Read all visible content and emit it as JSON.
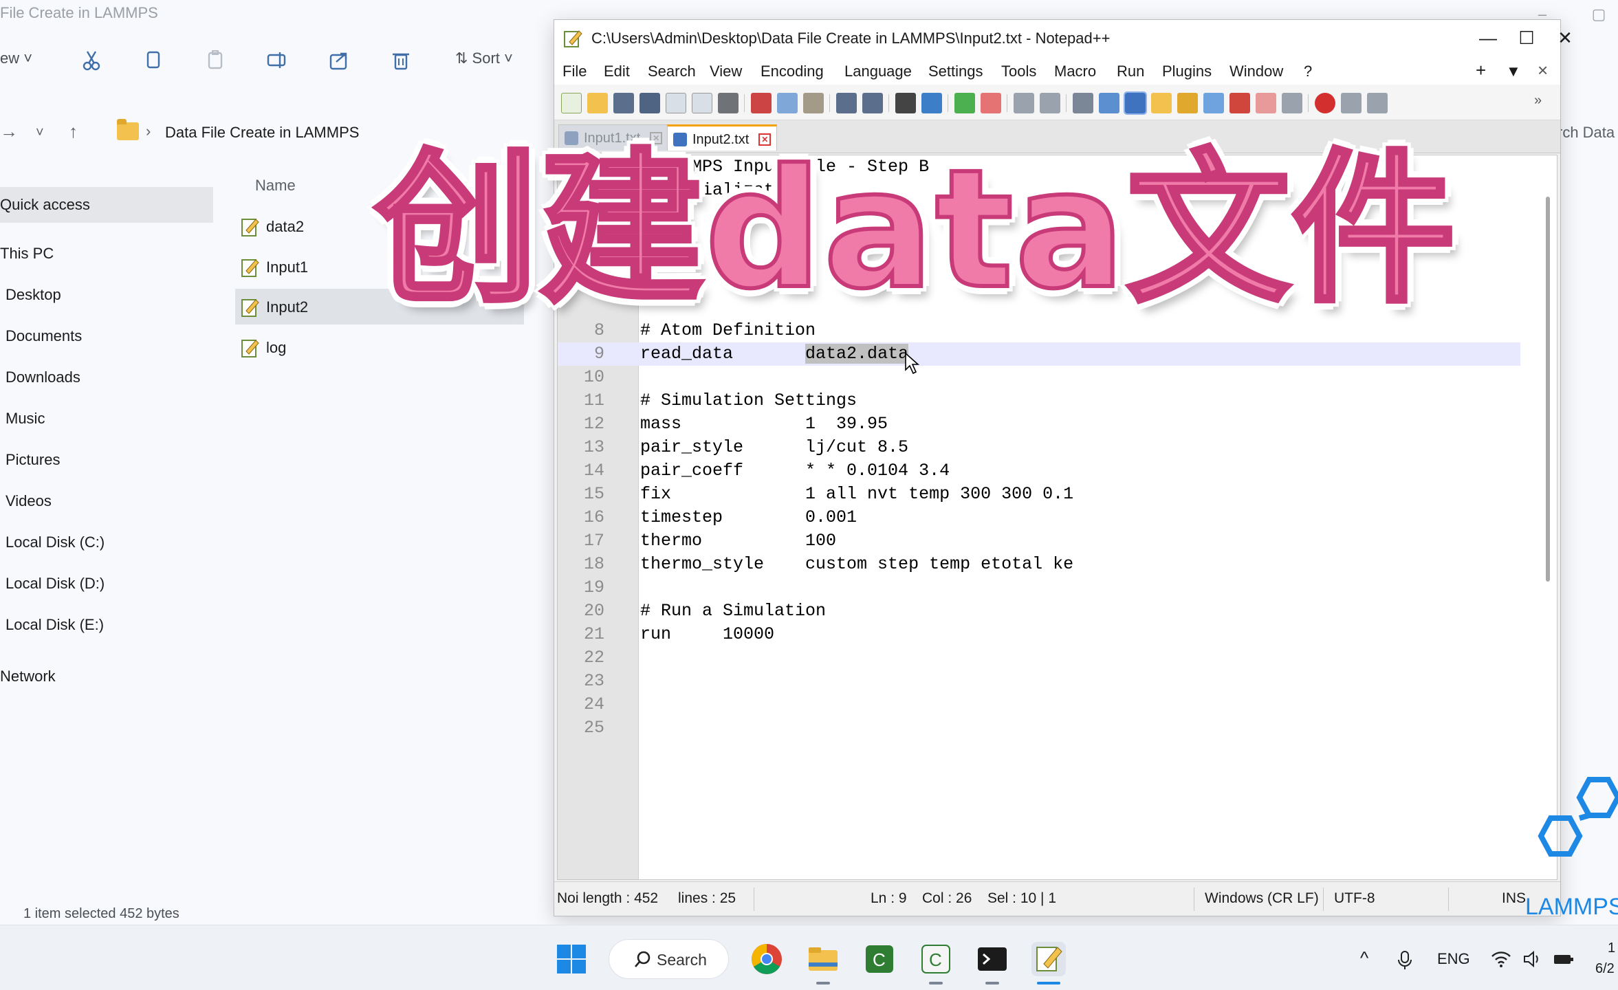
{
  "explorer": {
    "title": "File Create in LAMMPS",
    "toolbar": {
      "view_label": "ew",
      "sort_label": "Sort"
    },
    "address": {
      "crumb": "Data File Create in LAMMPS"
    },
    "search_hint": "rch Data",
    "nav_items": [
      "Quick access",
      "This PC",
      "Desktop",
      "Documents",
      "Downloads",
      "Music",
      "Pictures",
      "Videos",
      "Local Disk (C:)",
      "Local Disk (D:)",
      "Local Disk (E:)",
      "Network"
    ],
    "column_name": "Name",
    "files": [
      "data2",
      "Input1",
      "Input2",
      "log"
    ],
    "status": "1 item selected  452 bytes"
  },
  "npp": {
    "title": "C:\\Users\\Admin\\Desktop\\Data File Create in LAMMPS\\Input2.txt - Notepad++",
    "menu": [
      "File",
      "Edit",
      "Search",
      "View",
      "Encoding",
      "Language",
      "Settings",
      "Tools",
      "Macro",
      "Run",
      "Plugins",
      "Window",
      "?"
    ],
    "menu_right": [
      "+",
      "▼",
      "×"
    ],
    "tabs": [
      {
        "label": "Input1.txt",
        "active": false
      },
      {
        "label": "Input2.txt",
        "active": true
      }
    ],
    "lines": [
      {
        "n": "1",
        "text": "# LAMMPS Input File - Step B"
      },
      {
        "n": "2",
        "text": "# Initialization"
      },
      {
        "n": "8",
        "text": "# Atom Definition"
      },
      {
        "n": "9",
        "pre": "read_data       ",
        "sel": "data2.data",
        "post": ""
      },
      {
        "n": "10",
        "text": ""
      },
      {
        "n": "11",
        "text": "# Simulation Settings"
      },
      {
        "n": "12",
        "text": "mass            1  39.95"
      },
      {
        "n": "13",
        "text": "pair_style      lj/cut 8.5"
      },
      {
        "n": "14",
        "text": "pair_coeff      * * 0.0104 3.4"
      },
      {
        "n": "15",
        "text": "fix             1 all nvt temp 300 300 0.1"
      },
      {
        "n": "16",
        "text": "timestep        0.001"
      },
      {
        "n": "17",
        "text": "thermo          100"
      },
      {
        "n": "18",
        "text": "thermo_style    custom step temp etotal ke"
      },
      {
        "n": "19",
        "text": ""
      },
      {
        "n": "20",
        "text": "# Run a Simulation"
      },
      {
        "n": "21",
        "text": "run     10000"
      },
      {
        "n": "22",
        "text": ""
      },
      {
        "n": "23",
        "text": ""
      },
      {
        "n": "24",
        "text": ""
      },
      {
        "n": "25",
        "text": ""
      }
    ],
    "status": {
      "length": "Noi length : 452",
      "lines": "lines : 25",
      "ln": "Ln : 9",
      "col": "Col : 26",
      "sel": "Sel : 10 | 1",
      "eol": "Windows (CR LF)",
      "encoding": "UTF-8",
      "mode": "INS"
    }
  },
  "overlay_title": "创建data文件",
  "logo_text": "LAMMPS",
  "taskbar": {
    "search_label": "Search",
    "tray_lang": "ENG",
    "clock_top": "1",
    "clock_bottom": "6/2"
  },
  "colors": {
    "overlay_fill": "#f07aa8",
    "overlay_stroke": "#c83a78",
    "tab_accent": "#f3a100",
    "logo_blue": "#1e88e5",
    "selection": "#c0c0c0",
    "current_line": "#e8e8ff"
  }
}
